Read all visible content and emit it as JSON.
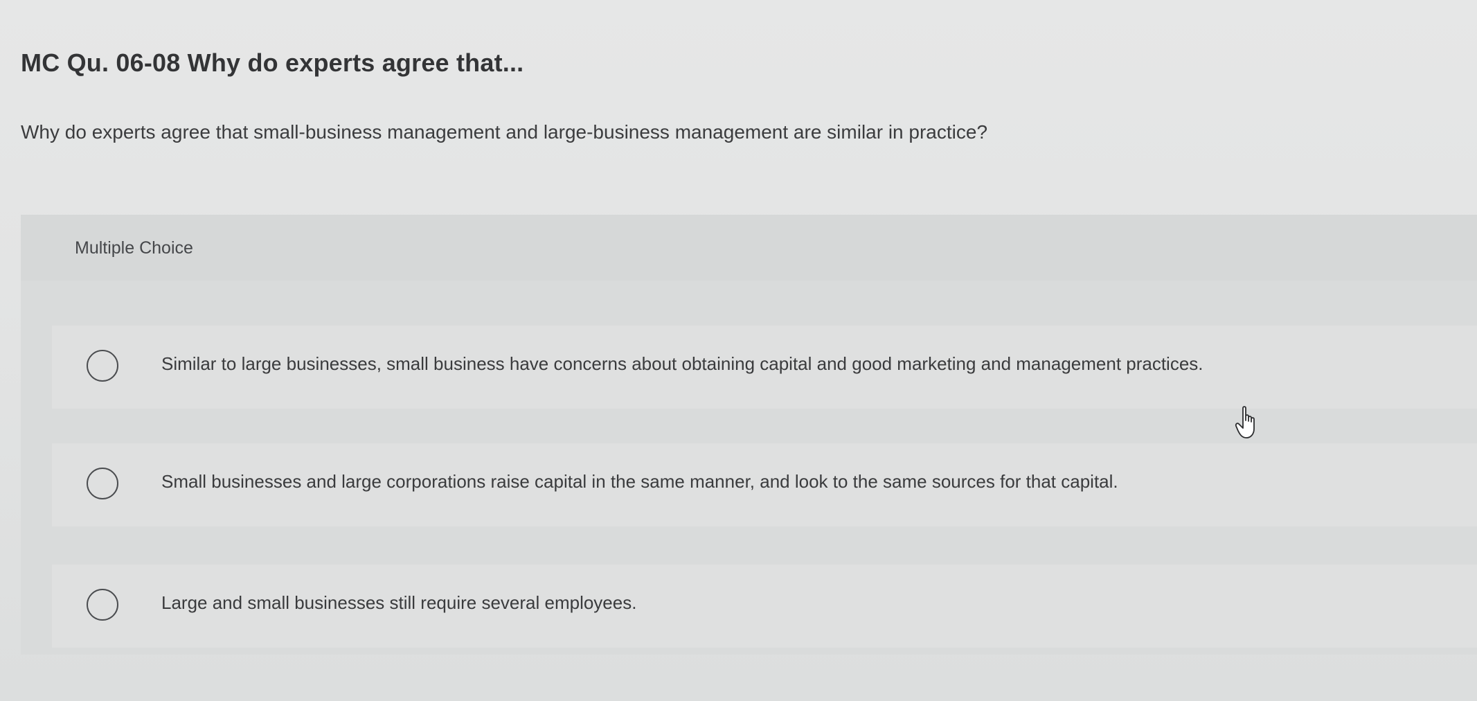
{
  "question": {
    "title": "MC Qu. 06-08 Why do experts agree that...",
    "prompt": "Why do experts agree that small-business management and large-business management are similar in practice?"
  },
  "multiple_choice": {
    "label": "Multiple Choice",
    "options": [
      {
        "text": "Similar to large businesses, small business have concerns about obtaining capital and good marketing and management practices.",
        "selected": false
      },
      {
        "text": "Small businesses and large corporations raise capital in the same manner, and look to the same sources for that capital.",
        "selected": false
      },
      {
        "text": "Large and small businesses still require several employees.",
        "selected": false
      }
    ]
  },
  "icons": {
    "radio": "radio-button-icon",
    "cursor": "hand-pointer-icon"
  },
  "colors": {
    "background": "#e4e5e5",
    "panel": "#d9dbdb",
    "text": "#3a3b3d"
  }
}
